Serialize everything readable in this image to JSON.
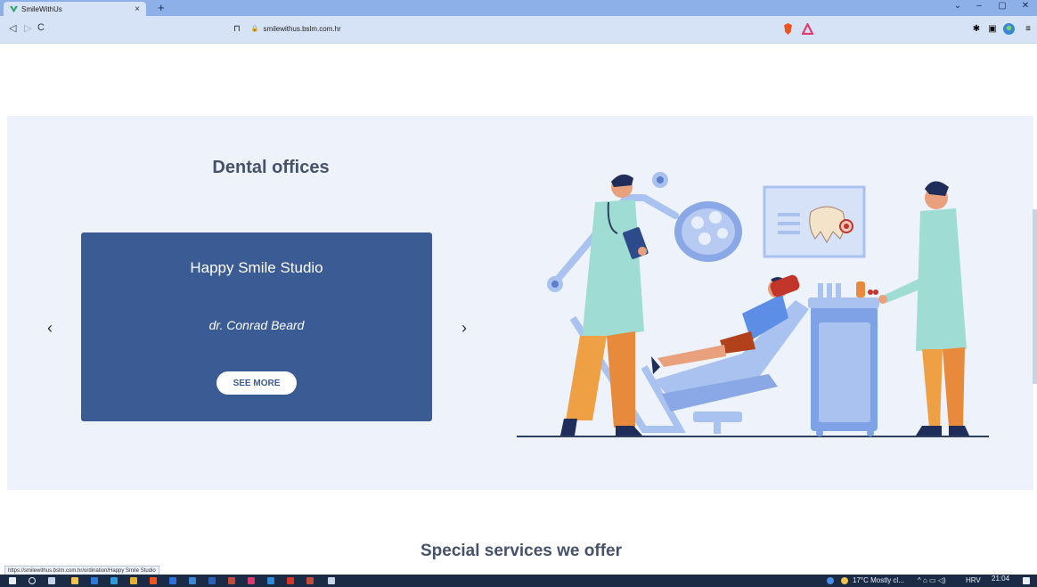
{
  "browser": {
    "tab_title": "SmileWithUs",
    "tab_close": "×",
    "new_tab": "+",
    "url": "smilewithus.bslm.com.hr",
    "status_link": "https://smilewithus.bslm.com.hr/ordination/Happy Smile Studio"
  },
  "page": {
    "dental_heading": "Dental offices",
    "carousel": {
      "office_name": "Happy Smile Studio",
      "doctor": "dr. Conrad Beard",
      "see_more": "SEE MORE",
      "prev": "‹",
      "next": "›"
    },
    "services_heading": "Special services we offer"
  },
  "taskbar": {
    "weather": "17°C  Mostly cl...",
    "language": "HRV",
    "time": "21:04"
  },
  "colors": {
    "card": "#3b5b95",
    "section_bg": "#eef3fb",
    "heading": "#46526a",
    "tabstrip": "#8db0e8",
    "toolbar": "#d6e3f7"
  }
}
